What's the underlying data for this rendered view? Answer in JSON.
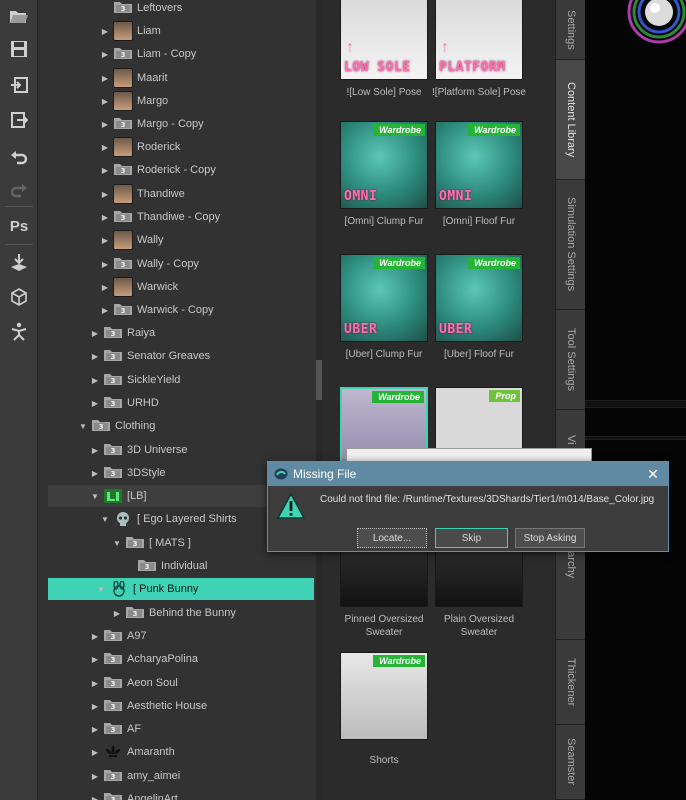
{
  "toolbar": {
    "buttons": [
      "open-icon",
      "save-icon",
      "merge-icon",
      "export-icon",
      "undo-icon",
      "redo-icon",
      "photoshop-bridge-icon",
      "drop-to-floor-icon",
      "iray-section-icon",
      "pose-icon"
    ],
    "ps_label": "Ps"
  },
  "tree": {
    "rows": [
      {
        "label": "Leftovers",
        "kind": "folder"
      },
      {
        "label": "Liam",
        "kind": "person"
      },
      {
        "label": "Liam - Copy",
        "kind": "folder"
      },
      {
        "label": "Maarit",
        "kind": "person"
      },
      {
        "label": "Margo",
        "kind": "person"
      },
      {
        "label": "Margo - Copy",
        "kind": "folder"
      },
      {
        "label": "Roderick",
        "kind": "person"
      },
      {
        "label": "Roderick - Copy",
        "kind": "folder"
      },
      {
        "label": "Thandiwe",
        "kind": "person"
      },
      {
        "label": "Thandiwe - Copy",
        "kind": "folder"
      },
      {
        "label": "Wally",
        "kind": "person"
      },
      {
        "label": "Wally - Copy",
        "kind": "folder"
      },
      {
        "label": "Warwick",
        "kind": "person"
      },
      {
        "label": "Warwick - Copy",
        "kind": "folder"
      },
      {
        "label": "Raiya",
        "kind": "folder"
      },
      {
        "label": "Senator Greaves",
        "kind": "folder"
      },
      {
        "label": "SickleYield",
        "kind": "folder"
      },
      {
        "label": "URHD",
        "kind": "folder"
      },
      {
        "label": "Clothing",
        "kind": "folder"
      },
      {
        "label": "3D Universe",
        "kind": "folder"
      },
      {
        "label": "3DStyle",
        "kind": "folder"
      },
      {
        "label": "[LB]",
        "kind": "lb"
      },
      {
        "label": "[ Ego Layered Shirts",
        "kind": "skull"
      },
      {
        "label": "[ MATS ]",
        "kind": "folder"
      },
      {
        "label": "Individual",
        "kind": "folder"
      },
      {
        "label": "[ Punk Bunny",
        "kind": "bunny"
      },
      {
        "label": "Behind the Bunny",
        "kind": "folder"
      },
      {
        "label": "A97",
        "kind": "folder"
      },
      {
        "label": "AcharyaPolina",
        "kind": "folder"
      },
      {
        "label": "Aeon Soul",
        "kind": "folder"
      },
      {
        "label": "Aesthetic House",
        "kind": "folder"
      },
      {
        "label": "AF",
        "kind": "folder"
      },
      {
        "label": "Amaranth",
        "kind": "fleur"
      },
      {
        "label": "amy_aimei",
        "kind": "folder"
      },
      {
        "label": "AngelinArt",
        "kind": "folder"
      }
    ]
  },
  "cards": [
    {
      "caption": "![Low Sole] Pose",
      "big": "LOW SOLE",
      "tag": ""
    },
    {
      "caption": "![Platform Sole] Pose",
      "big": "PLATFORM",
      "tag": ""
    },
    {
      "caption": "[Omni] Clump Fur",
      "big": "OMNI",
      "tag": "Wardrobe"
    },
    {
      "caption": "[Omni] Floof Fur",
      "big": "OMNI",
      "tag": "Wardrobe"
    },
    {
      "caption": "[Uber] Clump Fur",
      "big": "UBER",
      "tag": "Wardrobe"
    },
    {
      "caption": "[Uber] Floof Fur",
      "big": "UBER",
      "tag": "Wardrobe"
    },
    {
      "caption": "",
      "big": "",
      "tag": "Wardrobe"
    },
    {
      "caption": "",
      "big": "",
      "tag": "Prop"
    },
    {
      "caption": "Pinned Oversized Sweater",
      "big": "",
      "tag": ""
    },
    {
      "caption": "Plain Oversized Sweater",
      "big": "",
      "tag": ""
    },
    {
      "caption": "Shorts",
      "big": "",
      "tag": "Wardrobe"
    }
  ],
  "tabs": [
    "Settings",
    "Content Library",
    "Simulation Settings",
    "Tool Settings",
    "Vi",
    "Hierarchy",
    "Thickener",
    "Seamster"
  ],
  "dialog": {
    "title": "Missing File",
    "message": "Could not find file: /Runtime/Textures/3DShards/Tier1/m014/Base_Color.jpg",
    "locate": "Locate...",
    "skip": "Skip",
    "stop": "Stop Asking"
  },
  "colors": {
    "accent": "#3fd3b5",
    "wardrobe_tag": "#26b436",
    "dialog_title": "#5f8aa2"
  }
}
